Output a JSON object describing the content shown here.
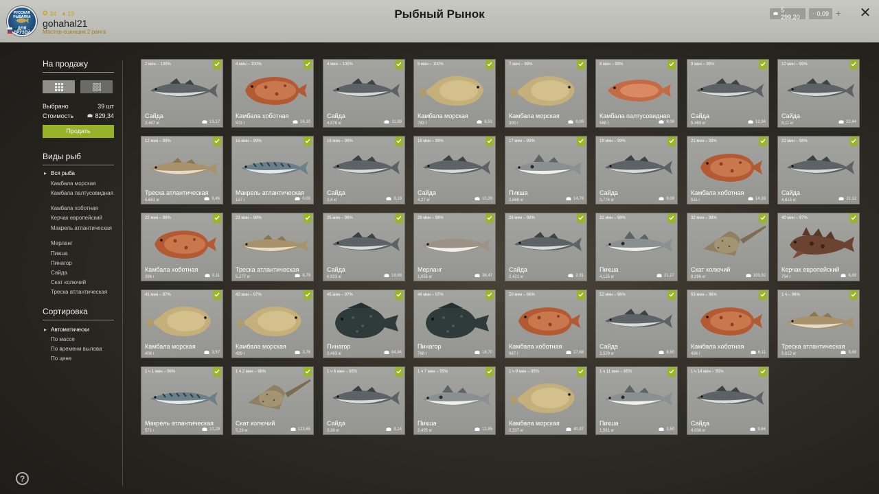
{
  "header": {
    "title": "Рыбный Рынок",
    "username": "gohahal21",
    "stat_level": "34",
    "stat_second": "19",
    "subline": "Мастер-оценщик 2 ранга",
    "silver": "5 299,20",
    "gold": "0,09",
    "plus_label": "+",
    "close_label": "✕",
    "logo_line1": "РУССКАЯ РЫБАЛКА",
    "logo_line2": "ДЛЯ",
    "logo_line3": "ДРУЗЕЙ"
  },
  "sidebar": {
    "for_sale_title": "На продажу",
    "selected_label": "Выбрано",
    "selected_value": "39 шт",
    "cost_label": "Стоимость",
    "cost_value": "829,34",
    "sell_button": "Продать",
    "species_title": "Виды рыб",
    "species": [
      "Вся рыба",
      "Камбала морская",
      "Камбала палтусовидная",
      "Камбала хоботная",
      "Керчак европейский",
      "Макрель атлантическая",
      "Мерланг",
      "Пикша",
      "Пинагор",
      "Сайда",
      "Скат колючий",
      "Треска атлантическая"
    ],
    "sort_title": "Сортировка",
    "sort": [
      "Автоматически",
      "По массе",
      "По времени вылова",
      "По цене"
    ],
    "help_label": "?"
  },
  "colors": {
    "accent_green": "#99b52b",
    "header_bg": "#c2c2bc",
    "card_bg": "#9e9e9b"
  },
  "cards": [
    {
      "time": "2 мин – 100%",
      "name": "Сайда",
      "weight": "3,467 кг",
      "price": "13,17",
      "fish": "saithe"
    },
    {
      "time": "4 мин – 100%",
      "name": "Камбала хоботная",
      "weight": "574 г",
      "price": "16,10",
      "fish": "plaice"
    },
    {
      "time": "4 мин – 100%",
      "name": "Сайда",
      "weight": "4,976 кг",
      "price": "11,99",
      "fish": "saithe"
    },
    {
      "time": "5 мин – 100%",
      "name": "Камбала морская",
      "weight": "743 г",
      "price": "6,51",
      "fish": "flounder"
    },
    {
      "time": "7 мин – 99%",
      "name": "Камбала морская",
      "weight": "300 г",
      "price": "0,09",
      "fish": "flounder"
    },
    {
      "time": "8 мин – 99%",
      "name": "Камбала палтусовидная",
      "weight": "588 г",
      "price": "8,08",
      "fish": "dab"
    },
    {
      "time": "9 мин – 99%",
      "name": "Сайда",
      "weight": "5,369 кг",
      "price": "12,94",
      "fish": "saithe"
    },
    {
      "time": "10 мин – 99%",
      "name": "Сайда",
      "weight": "9,11 кг",
      "price": "22,44",
      "fish": "saithe"
    },
    {
      "time": "12 мин – 99%",
      "name": "Треска атлантическая",
      "weight": "5,681 кг",
      "price": "9,46",
      "fish": "cod"
    },
    {
      "time": "15 мин – 99%",
      "name": "Макрель атлантическая",
      "weight": "127 г",
      "price": "0,03",
      "fish": "mackerel"
    },
    {
      "time": "16 мин – 99%",
      "name": "Сайда",
      "weight": "3,4 кг",
      "price": "8,19",
      "fish": "saithe"
    },
    {
      "time": "16 мин – 99%",
      "name": "Сайда",
      "weight": "4,27 кг",
      "price": "10,29",
      "fish": "saithe"
    },
    {
      "time": "17 мин – 99%",
      "name": "Пикша",
      "weight": "2,868 кг",
      "price": "14,78",
      "fish": "haddock"
    },
    {
      "time": "19 мин – 99%",
      "name": "Сайда",
      "weight": "3,774 кг",
      "price": "9,09",
      "fish": "saithe"
    },
    {
      "time": "21 мин – 99%",
      "name": "Камбала хоботная",
      "weight": "511 г",
      "price": "14,33",
      "fish": "plaice"
    },
    {
      "time": "22 мин – 98%",
      "name": "Сайда",
      "weight": "4,615 кг",
      "price": "11,12",
      "fish": "saithe"
    },
    {
      "time": "22 мин – 98%",
      "name": "Камбала хоботная",
      "weight": "396 г",
      "price": "0,11",
      "fish": "plaice"
    },
    {
      "time": "23 мин – 98%",
      "name": "Треска атлантическая",
      "weight": "5,277 кг",
      "price": "8,79",
      "fish": "cod"
    },
    {
      "time": "25 мин – 98%",
      "name": "Сайда",
      "weight": "6,923 кг",
      "price": "16,68",
      "fish": "saithe"
    },
    {
      "time": "26 мин – 98%",
      "name": "Мерланг",
      "weight": "1,055 кг",
      "price": "38,47",
      "fish": "whiting"
    },
    {
      "time": "28 мин – 98%",
      "name": "Сайда",
      "weight": "2,421 кг",
      "price": "2,91",
      "fish": "saithe"
    },
    {
      "time": "31 мин – 98%",
      "name": "Пикша",
      "weight": "4,125 кг",
      "price": "21,27",
      "fish": "haddock"
    },
    {
      "time": "32 мин – 98%",
      "name": "Скат колючий",
      "weight": "8,296 кг",
      "price": "193,92",
      "fish": "ray"
    },
    {
      "time": "40 мин – 97%",
      "name": "Керчак европейский",
      "weight": "794 г",
      "price": "6,68",
      "fish": "sculpin"
    },
    {
      "time": "41 мин – 97%",
      "name": "Камбала морская",
      "weight": "408 г",
      "price": "3,57",
      "fish": "flounder"
    },
    {
      "time": "42 мин – 97%",
      "name": "Камбала морская",
      "weight": "429 г",
      "price": "3,76",
      "fish": "flounder"
    },
    {
      "time": "45 мин – 97%",
      "name": "Пинагор",
      "weight": "3,463 кг",
      "price": "84,84",
      "fish": "lumpsucker"
    },
    {
      "time": "46 мин – 97%",
      "name": "Пинагор",
      "weight": "768 г",
      "price": "18,70",
      "fish": "lumpsucker"
    },
    {
      "time": "50 мин – 96%",
      "name": "Камбала хоботная",
      "weight": "987 г",
      "price": "27,68",
      "fish": "plaice"
    },
    {
      "time": "52 мин – 96%",
      "name": "Сайда",
      "weight": "3,529 кг",
      "price": "8,50",
      "fish": "saithe"
    },
    {
      "time": "53 мин – 96%",
      "name": "Камбала хоботная",
      "weight": "436 г",
      "price": "6,11",
      "fish": "plaice"
    },
    {
      "time": "1 ч – 96%",
      "name": "Треска атлантическая",
      "weight": "5,812 кг",
      "price": "9,68",
      "fish": "cod"
    },
    {
      "time": "1 ч 1 мин – 96%",
      "name": "Макрель атлантическая",
      "weight": "571 г",
      "price": "10,29",
      "fish": "mackerel"
    },
    {
      "time": "1 ч 2 мин – 96%",
      "name": "Скат колючий",
      "weight": "5,29 кг",
      "price": "123,65",
      "fish": "ray"
    },
    {
      "time": "1 ч 6 мин – 95%",
      "name": "Сайда",
      "weight": "3,38 кг",
      "price": "8,14",
      "fish": "saithe"
    },
    {
      "time": "1 ч 7 мин – 95%",
      "name": "Пикша",
      "weight": "2,495 кг",
      "price": "12,85",
      "fish": "haddock"
    },
    {
      "time": "1 ч 9 мин – 95%",
      "name": "Камбала морская",
      "weight": "2,337 кг",
      "price": "40,97",
      "fish": "flounder"
    },
    {
      "time": "1 ч 11 мин – 95%",
      "name": "Пикша",
      "weight": "1,561 кг",
      "price": "3,50",
      "fish": "haddock"
    },
    {
      "time": "1 ч 14 мин – 95%",
      "name": "Сайда",
      "weight": "4,008 кг",
      "price": "9,66",
      "fish": "saithe"
    }
  ]
}
